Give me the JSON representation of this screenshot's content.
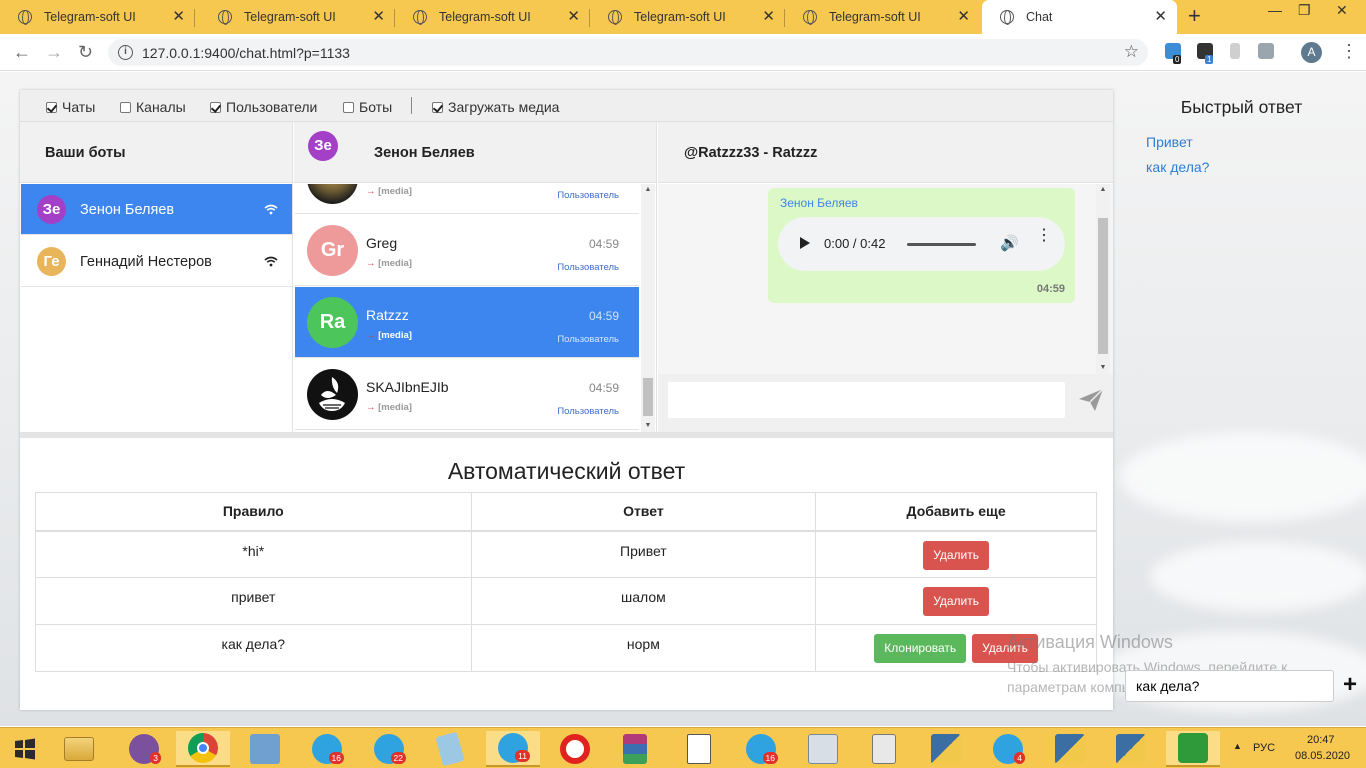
{
  "browser": {
    "tabs": [
      {
        "title": "Telegram-soft UI",
        "active": false
      },
      {
        "title": "Telegram-soft UI",
        "active": false
      },
      {
        "title": "Telegram-soft UI",
        "active": false
      },
      {
        "title": "Telegram-soft UI",
        "active": false
      },
      {
        "title": "Telegram-soft UI",
        "active": false
      },
      {
        "title": "Chat",
        "active": true
      }
    ],
    "url": "127.0.0.1:9400/chat.html?p=1133",
    "profile_initial": "A",
    "extension_badges": [
      "0",
      "1"
    ]
  },
  "filters": {
    "chats": {
      "label": "Чаты",
      "checked": true
    },
    "channels": {
      "label": "Каналы",
      "checked": false
    },
    "users": {
      "label": "Пользователи",
      "checked": true
    },
    "bots": {
      "label": "Боты",
      "checked": false
    },
    "separator": "|",
    "load_media": {
      "label": "Загружать медиа",
      "checked": true
    }
  },
  "bots_panel": {
    "title": "Ваши боты",
    "items": [
      {
        "initials": "Зе",
        "name": "Зенон Беляев",
        "color": "#a43fc7",
        "active": true
      },
      {
        "initials": "Ге",
        "name": "Геннадий Нестеров",
        "color": "#e9b55a",
        "active": false
      }
    ]
  },
  "contacts_panel": {
    "bot_initials": "Зе",
    "bot_color": "#a43fc7",
    "title": "Зенон Беляев",
    "items": [
      {
        "initials": "",
        "name": "",
        "time": "",
        "preview": "[media]",
        "type": "Пользователь",
        "color": "#6b5a33",
        "active": false
      },
      {
        "initials": "Gr",
        "name": "Greg",
        "time": "04:59",
        "preview": "[media]",
        "type": "Пользователь",
        "color": "#ef9a9a",
        "active": false
      },
      {
        "initials": "Ra",
        "name": "Ratzzz",
        "time": "04:59",
        "preview": "[media]",
        "type": "Пользователь",
        "color": "#4cc65a",
        "active": true
      },
      {
        "initials": "",
        "name": "SKAJIbnEJIb",
        "time": "04:59",
        "preview": "[media]",
        "type": "Пользователь",
        "color": "#111111",
        "active": false
      }
    ]
  },
  "chat_panel": {
    "title": "@Ratzzz33 - Ratzzz",
    "message": {
      "sender": "Зенон Беляев",
      "audio_time": "0:00 / 0:42",
      "time": "04:59"
    },
    "input_value": ""
  },
  "auto_reply": {
    "title": "Автоматический ответ",
    "headers": [
      "Правило",
      "Ответ",
      "Добавить еще"
    ],
    "rows": [
      {
        "rule": "*hi*",
        "answer": "Привет",
        "clone": false
      },
      {
        "rule": "привет",
        "answer": "шалом",
        "clone": false
      },
      {
        "rule": "как дела?",
        "answer": "норм",
        "clone": true
      }
    ],
    "delete_label": "Удалить",
    "clone_label": "Клонировать"
  },
  "quick_reply": {
    "title": "Быстрый ответ",
    "items": [
      "Привет",
      "как дела?"
    ],
    "input_value": "как дела?",
    "add_symbol": "+"
  },
  "watermark": {
    "line1": "Активация Windows",
    "line2": "Чтобы активировать Windows, перейдите к",
    "line3": "параметрам компьютера."
  },
  "taskbar": {
    "badges": [
      "3",
      "16",
      "22",
      "11",
      "16",
      "4"
    ],
    "lang": "РУС",
    "time": "20:47",
    "date": "08.05.2020"
  },
  "colors": {
    "tab_strip": "#f7c84f",
    "accent_blue": "#3d86ef",
    "bubble": "#dcf8c6",
    "delete": "#d9534f",
    "clone": "#5cb85c",
    "link": "#2a7fd9"
  }
}
